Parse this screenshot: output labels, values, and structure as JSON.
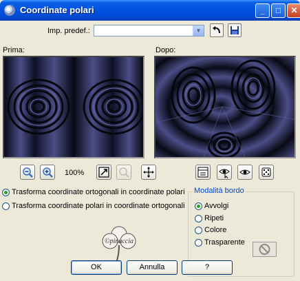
{
  "window": {
    "title": "Coordinate polari",
    "buttons": {
      "minimize": "_",
      "maximize": "□",
      "close": "✕"
    }
  },
  "presets": {
    "label": "Imp. predef.:",
    "value": ""
  },
  "previews": {
    "before_label": "Prima:",
    "after_label": "Dopo:"
  },
  "zoom": {
    "value": "100%"
  },
  "mode": {
    "options": [
      {
        "label": "Trasforma coordinate ortogonali in coordinate polari",
        "selected": true
      },
      {
        "label": "Trasforma coordinate polari in coordinate ortogonali",
        "selected": false
      }
    ]
  },
  "edge_mode": {
    "title": "Modalità bordo",
    "options": [
      {
        "label": "Avvolgi",
        "selected": true
      },
      {
        "label": "Ripeti",
        "selected": false
      },
      {
        "label": "Colore",
        "selected": false
      },
      {
        "label": "Trasparente",
        "selected": false
      }
    ]
  },
  "logo": {
    "text": "©pinuccia"
  },
  "actions": {
    "ok": "OK",
    "cancel": "Annulla",
    "help": "?"
  },
  "colors": {
    "title_bar": "#0054E3",
    "dialog_bg": "#ECE9D8",
    "preview_blue": "#4A4E86",
    "preview_dark": "#0A0A16",
    "group_title": "#0046D5"
  }
}
